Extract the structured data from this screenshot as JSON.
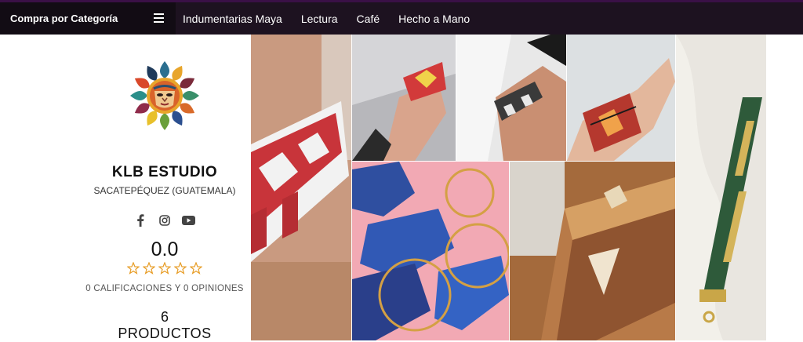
{
  "navbar": {
    "category_button": "Compra por Categoría",
    "menu_icon": "hamburger-menu-icon",
    "links": [
      "Indumentarias Maya",
      "Lectura",
      "Café",
      "Hecho a Mano"
    ]
  },
  "profile": {
    "logo_icon": "sun-mask-logo",
    "store_name": "KLB ESTUDIO",
    "location": "SACATEPÉQUEZ (GUATEMALA)",
    "social_icons": [
      "facebook-icon",
      "instagram-icon",
      "youtube-icon"
    ],
    "rating_value": "0.0",
    "rating_stars": 0,
    "reviews_text": "0 CALIFICACIONES Y 0 OPINIONES",
    "products_count": "6",
    "products_label": "PRODUCTOS"
  },
  "gallery": {
    "images": [
      "beaded-choker-photo",
      "beaded-bracelet-photo",
      "woven-bracelet-photo",
      "wrist-cuff-photo",
      "beaded-strap-photo",
      "beaded-earrings-photo",
      "fringe-necklace-photo"
    ]
  },
  "colors": {
    "nav_bg": "#1d1220",
    "category_bg": "#120c14",
    "star_outline": "#e79c25"
  }
}
